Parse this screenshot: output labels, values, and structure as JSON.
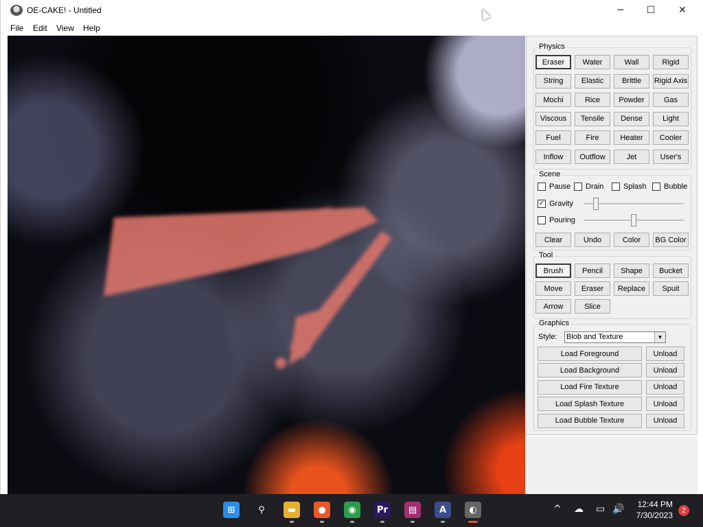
{
  "window": {
    "title": "OE-CAKE! - Untitled",
    "minimize_glyph": "─",
    "maximize_glyph": "☐",
    "close_glyph": "✕"
  },
  "menu": [
    "File",
    "Edit",
    "View",
    "Help"
  ],
  "physics": {
    "label": "Physics",
    "selected": "Eraser",
    "buttons": [
      "Eraser",
      "Water",
      "Wall",
      "Rigid",
      "String",
      "Elastic",
      "Brittle",
      "Rigid Axis",
      "Mochi",
      "Rice",
      "Powder",
      "Gas",
      "Viscous",
      "Tensile",
      "Dense",
      "Light",
      "Fuel",
      "Fire",
      "Heater",
      "Cooler",
      "Inflow",
      "Outflow",
      "Jet",
      "User's"
    ]
  },
  "scene": {
    "label": "Scene",
    "checks": [
      {
        "label": "Pause",
        "checked": false
      },
      {
        "label": "Drain",
        "checked": false
      },
      {
        "label": "Splash",
        "checked": false
      },
      {
        "label": "Bubble",
        "checked": false
      }
    ],
    "gravity": {
      "label": "Gravity",
      "checked": true,
      "level": 0.1
    },
    "pouring": {
      "label": "Pouring",
      "checked": false,
      "level": 0.5
    },
    "buttons": [
      "Clear",
      "Undo",
      "Color",
      "BG Color"
    ]
  },
  "tool": {
    "label": "Tool",
    "selected": "Brush",
    "buttons": [
      "Brush",
      "Pencil",
      "Shape",
      "Bucket",
      "Move",
      "Eraser",
      "Replace",
      "Spuit",
      "Arrow",
      "Slice"
    ]
  },
  "graphics": {
    "label": "Graphics",
    "style_label": "Style:",
    "style_value": "Blob and Texture",
    "loads": [
      "Load Foreground",
      "Load Background",
      "Load Fire Texture",
      "Load Splash Texture",
      "Load Bubble Texture"
    ],
    "unload_label": "Unload"
  },
  "taskbar": {
    "apps": [
      {
        "name": "start-icon",
        "glyph": "⊞",
        "color": "#2b8ce6"
      },
      {
        "name": "search-icon",
        "glyph": "⚲",
        "color": "transparent"
      },
      {
        "name": "file-explorer-icon",
        "glyph": "▬",
        "color": "#e8b030"
      },
      {
        "name": "firefox-icon",
        "glyph": "●",
        "color": "#e8582a"
      },
      {
        "name": "chrome-icon",
        "glyph": "◉",
        "color": "#2e9d4b"
      },
      {
        "name": "premiere-icon",
        "glyph": "Pr",
        "color": "#2a1a5c"
      },
      {
        "name": "winrar-icon",
        "glyph": "▤",
        "color": "#a03070"
      },
      {
        "name": "app-a-icon",
        "glyph": "A",
        "color": "#3a4d8c"
      },
      {
        "name": "oecake-icon",
        "glyph": "◐",
        "color": "#666"
      }
    ],
    "tray": [
      "^",
      "☁",
      "▭",
      "🔊"
    ],
    "time": "12:44 PM",
    "date": "7/30/2023",
    "notifications": "2"
  }
}
